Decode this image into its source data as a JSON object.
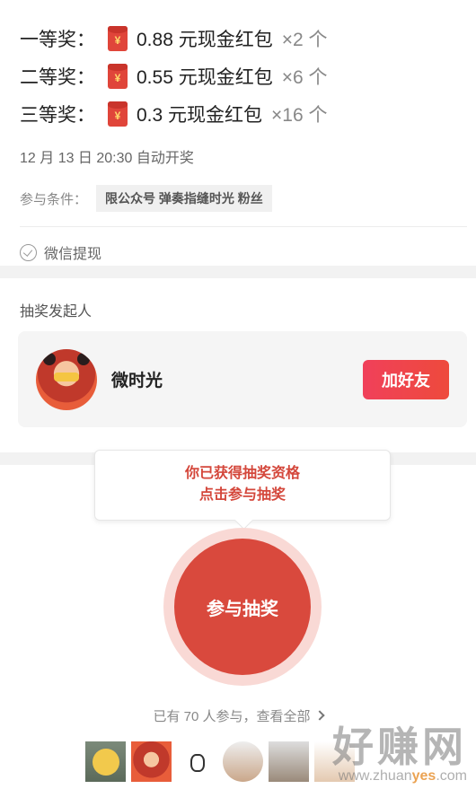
{
  "prizes": [
    {
      "name": "一等奖：",
      "amount": "0.88 元现金红包",
      "count": "×2 个"
    },
    {
      "name": "二等奖：",
      "amount": "0.55 元现金红包",
      "count": "×6 个"
    },
    {
      "name": "三等奖：",
      "amount": "0.3 元现金红包",
      "count": "×16 个"
    }
  ],
  "packet_symbol": "¥",
  "draw_time": "12 月 13 日 20:30 自动开奖",
  "condition": {
    "label": "参与条件：",
    "value": "限公众号 弹奏指缝时光 粉丝"
  },
  "wechat_withdraw": "微信提现",
  "sponsor": {
    "title": "抽奖发起人",
    "name": "微时光",
    "add_friend": "加好友"
  },
  "tooltip": {
    "line1": "你已获得抽奖资格",
    "line2": "点击参与抽奖"
  },
  "draw_button": "参与抽奖",
  "participants_text": "已有 70 人参与，查看全部",
  "watermark": {
    "big": "好赚网",
    "small_prefix": "www.zhuan",
    "small_highlight": "yes",
    "small_suffix": ".com"
  },
  "colors": {
    "accent": "#d9493d",
    "button": "#f0405a"
  }
}
